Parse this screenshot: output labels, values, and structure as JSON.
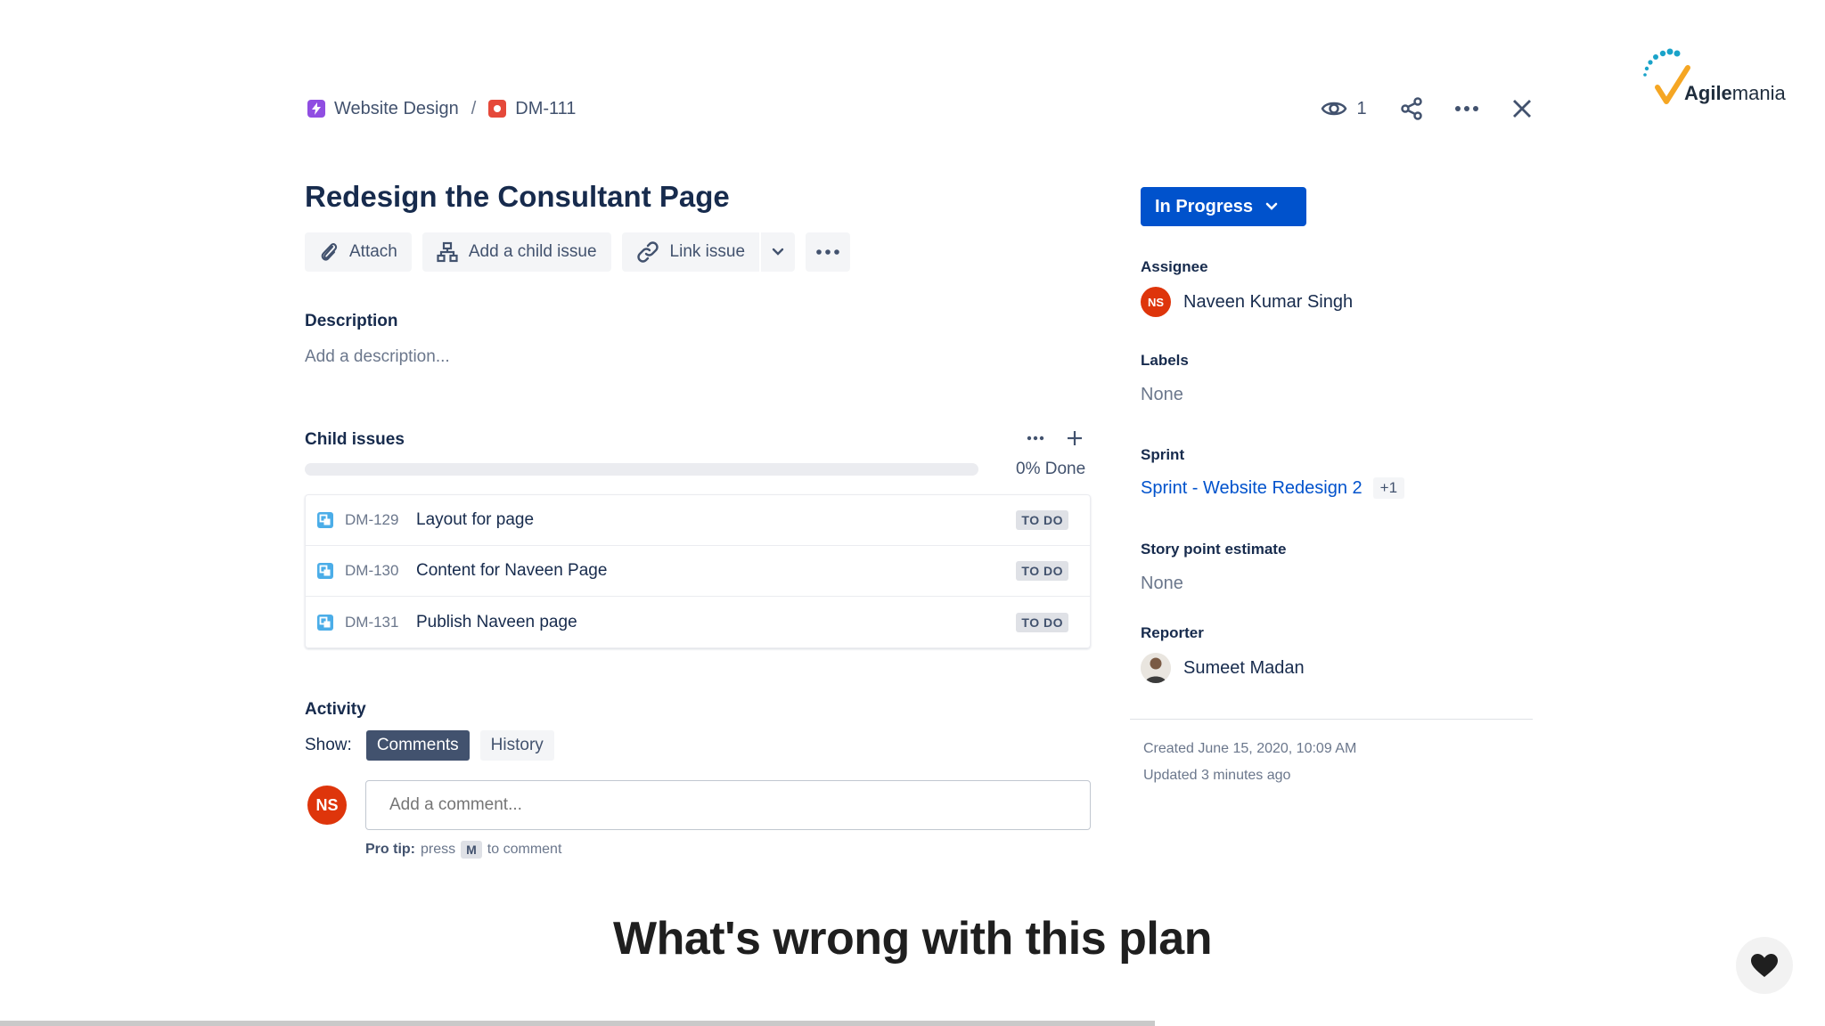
{
  "breadcrumb": {
    "project": "Website Design",
    "separator": "/",
    "issue_key": "DM-111"
  },
  "top_actions": {
    "watchers_count": "1"
  },
  "logo": {
    "brand_bold": "Agile",
    "brand_light": "mania"
  },
  "issue": {
    "title": "Redesign the Consultant Page"
  },
  "toolbar": {
    "attach_label": "Attach",
    "add_child_label": "Add a child issue",
    "link_issue_label": "Link issue"
  },
  "description": {
    "label": "Description",
    "placeholder": "Add a description..."
  },
  "child_issues": {
    "label": "Child issues",
    "progress_label": "0% Done",
    "progress_fraction": 0,
    "items": [
      {
        "key": "DM-129",
        "summary": "Layout for page",
        "status": "TO DO"
      },
      {
        "key": "DM-130",
        "summary": "Content for Naveen Page",
        "status": "TO DO"
      },
      {
        "key": "DM-131",
        "summary": "Publish Naveen page",
        "status": "TO DO"
      }
    ]
  },
  "activity": {
    "label": "Activity",
    "show_label": "Show:",
    "comments_label": "Comments",
    "history_label": "History",
    "user_initials": "NS",
    "comment_placeholder": "Add a comment...",
    "protip_bold": "Pro tip:",
    "protip_press": "press",
    "protip_key": "M",
    "protip_suffix": "to comment"
  },
  "side_panel": {
    "status_label": "In Progress",
    "assignee_label": "Assignee",
    "assignee_initials": "NS",
    "assignee_name": "Naveen Kumar Singh",
    "labels_label": "Labels",
    "labels_value": "None",
    "sprint_label": "Sprint",
    "sprint_value": "Sprint - Website Redesign 2",
    "sprint_more": "+1",
    "story_points_label": "Story point estimate",
    "story_points_value": "None",
    "reporter_label": "Reporter",
    "reporter_name": "Sumeet Madan",
    "created": "Created June 15, 2020, 10:09 AM",
    "updated": "Updated 3 minutes ago"
  },
  "caption": "What's wrong with this plan",
  "video_progress_fraction": 0.633,
  "colors": {
    "primary": "#0052cc",
    "avatar_red": "#de350b",
    "epic_purple": "#904ee2",
    "bug_red": "#e5493a",
    "subtask_blue": "#4bade8"
  }
}
